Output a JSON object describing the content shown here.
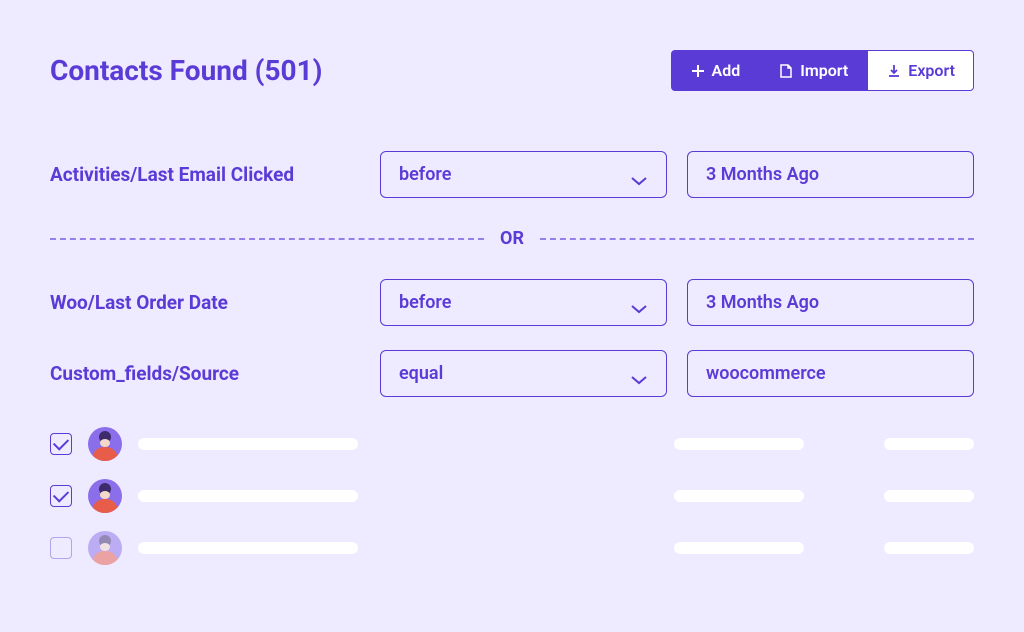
{
  "header": {
    "title": "Contacts Found (501)",
    "buttons": {
      "add": "Add",
      "import": "Import",
      "export": "Export"
    }
  },
  "filters": [
    {
      "label": "Activities/Last Email Clicked",
      "operator": "before",
      "value": "3 Months Ago"
    }
  ],
  "divider": "OR",
  "filters2": [
    {
      "label": "Woo/Last Order Date",
      "operator": "before",
      "value": "3 Months Ago"
    },
    {
      "label": "Custom_fields/Source",
      "operator": "equal",
      "value": "woocommerce"
    }
  ],
  "contacts": [
    {
      "checked": true,
      "faded": false
    },
    {
      "checked": true,
      "faded": false
    },
    {
      "checked": false,
      "faded": true
    }
  ],
  "colors": {
    "primary": "#5a3bd6",
    "background": "#eeeaff"
  }
}
